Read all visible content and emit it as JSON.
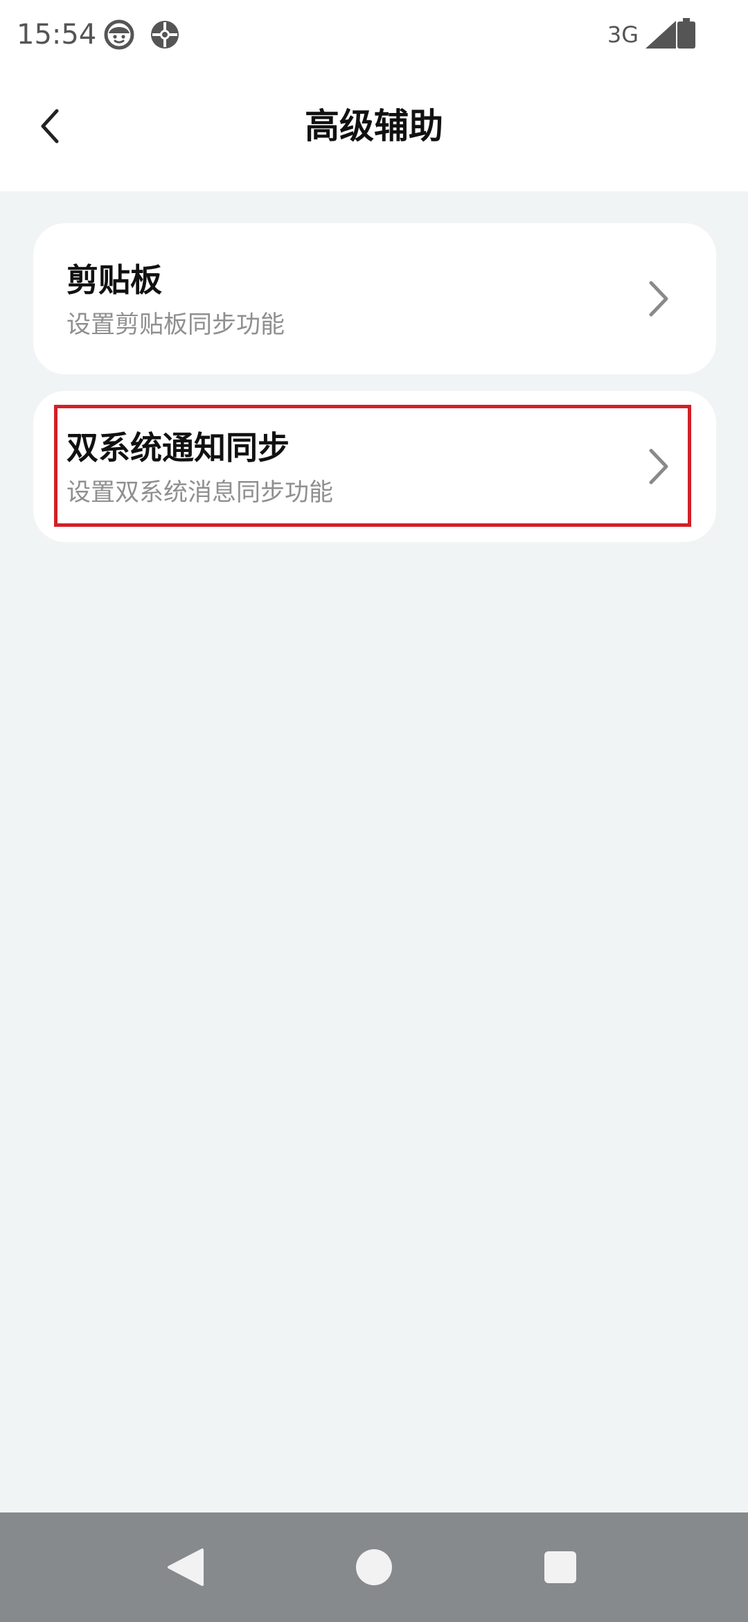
{
  "status_bar": {
    "time": "15:54",
    "network": "3G",
    "icons": [
      "face-notification-icon",
      "ball-notification-icon",
      "signal-icon",
      "battery-icon"
    ]
  },
  "header": {
    "title": "高级辅助",
    "back_icon": "chevron-left-icon"
  },
  "items": [
    {
      "title": "剪贴板",
      "subtitle": "设置剪贴板同步功能",
      "icon": "chevron-right-icon"
    },
    {
      "title": "双系统通知同步",
      "subtitle": "设置双系统消息同步功能",
      "icon": "chevron-right-icon",
      "highlighted": true
    }
  ],
  "nav_bar": {
    "icons": [
      "nav-back-icon",
      "nav-home-icon",
      "nav-recent-icon"
    ]
  },
  "colors": {
    "background": "#f1f4f5",
    "card": "#ffffff",
    "highlight": "#d32027",
    "nav_bar": "#878a8c",
    "subtitle": "#8f8f8f"
  }
}
